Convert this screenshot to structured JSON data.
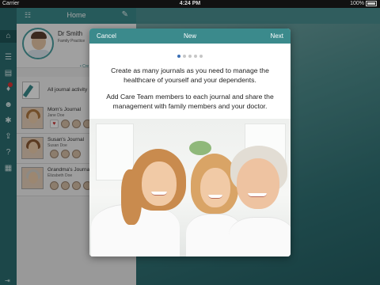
{
  "status_bar": {
    "carrier": "Carrier",
    "time": "4:24 PM",
    "battery": "100%"
  },
  "rail": {
    "icons": [
      "home-icon",
      "list-icon",
      "grid-icon",
      "alert-icon",
      "person-icon",
      "gear-icon",
      "share-icon",
      "help-icon",
      "card-icon",
      "arrow-icon"
    ]
  },
  "panel": {
    "title": "Home",
    "profile": {
      "name": "Dr Smith",
      "role": "Family Practice"
    },
    "all_journals_label": "All journal activity",
    "create_link": "• Cre",
    "journals": [
      {
        "title": "Mom's Journal",
        "owner": "Jane Doe"
      },
      {
        "title": "Susan's Journal",
        "owner": "Susan Doe"
      },
      {
        "title": "Grandma's Journal",
        "owner": "Elizabeth Doe"
      }
    ]
  },
  "modal": {
    "cancel_label": "Cancel",
    "title": "New",
    "next_label": "Next",
    "page_count": 5,
    "current_page": 1,
    "paragraph_1": "Create as many journals as you need to manage the healthcare of yourself and your dependents.",
    "paragraph_2": "Add Care Team members to each journal and share the management with family members and your doctor."
  },
  "colors": {
    "accent": "#3b8a8c",
    "rail": "#2c6e70",
    "panel_bg": "#ececec",
    "dot_active": "#3b6fb5"
  }
}
